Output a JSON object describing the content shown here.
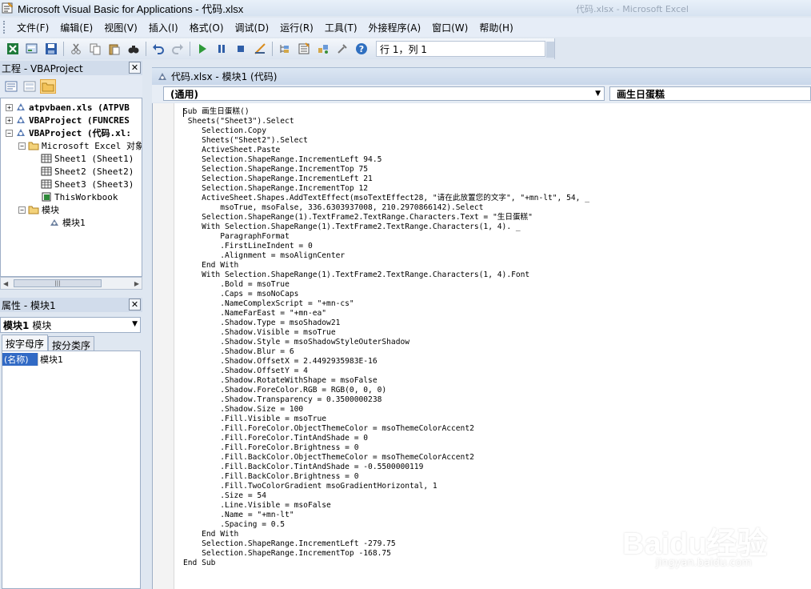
{
  "window": {
    "title": "Microsoft Visual Basic for Applications - 代码.xlsx",
    "background_window_title": "代码.xlsx - Microsoft Excel"
  },
  "menu": {
    "items": [
      "文件(F)",
      "编辑(E)",
      "视图(V)",
      "插入(I)",
      "格式(O)",
      "调试(D)",
      "运行(R)",
      "工具(T)",
      "外接程序(A)",
      "窗口(W)",
      "帮助(H)"
    ]
  },
  "toolbar": {
    "position_text": "行 1，列 1"
  },
  "project": {
    "title": "工程 - VBAProject",
    "tree": [
      "atpvbaen.xls (ATPVB",
      "VBAProject (FUNCRES",
      "VBAProject (代码.xl:",
      "Microsoft Excel 对象",
      "Sheet1 (Sheet1)",
      "Sheet2 (Sheet2)",
      "Sheet3 (Sheet3)",
      "ThisWorkbook",
      "模块",
      "模块1"
    ]
  },
  "properties": {
    "title": "属性 - 模块1",
    "object_name": "模块1",
    "object_type": "模块",
    "tabs": [
      "按字母序",
      "按分类序"
    ],
    "row_key": "(名称)",
    "row_value": "模块1"
  },
  "code_window": {
    "title": "代码.xlsx - 模块1 (代码)",
    "object_combo": "(通用)",
    "procedure_combo": "画生日蛋糕",
    "lines": [
      "Sub 画生日蛋糕()",
      " Sheets(\"Sheet3\").Select",
      "    Selection.Copy",
      "    Sheets(\"Sheet2\").Select",
      "    ActiveSheet.Paste",
      "    Selection.ShapeRange.IncrementLeft 94.5",
      "    Selection.ShapeRange.IncrementTop 75",
      "    Selection.ShapeRange.IncrementLeft 21",
      "    Selection.ShapeRange.IncrementTop 12",
      "    ActiveSheet.Shapes.AddTextEffect(msoTextEffect28, \"请在此放置您的文字\", \"+mn-lt\", 54, _",
      "        msoTrue, msoFalse, 336.6303937008, 210.2970866142).Select",
      "    Selection.ShapeRange(1).TextFrame2.TextRange.Characters.Text = \"生日蛋糕\"",
      "    With Selection.ShapeRange(1).TextFrame2.TextRange.Characters(1, 4). _",
      "        ParagraphFormat",
      "        .FirstLineIndent = 0",
      "        .Alignment = msoAlignCenter",
      "    End With",
      "    With Selection.ShapeRange(1).TextFrame2.TextRange.Characters(1, 4).Font",
      "        .Bold = msoTrue",
      "        .Caps = msoNoCaps",
      "        .NameComplexScript = \"+mn-cs\"",
      "        .NameFarEast = \"+mn-ea\"",
      "        .Shadow.Type = msoShadow21",
      "        .Shadow.Visible = msoTrue",
      "        .Shadow.Style = msoShadowStyleOuterShadow",
      "        .Shadow.Blur = 6",
      "        .Shadow.OffsetX = 2.4492935983E-16",
      "        .Shadow.OffsetY = 4",
      "        .Shadow.RotateWithShape = msoFalse",
      "        .Shadow.ForeColor.RGB = RGB(0, 0, 0)",
      "        .Shadow.Transparency = 0.3500000238",
      "        .Shadow.Size = 100",
      "        .Fill.Visible = msoTrue",
      "        .Fill.ForeColor.ObjectThemeColor = msoThemeColorAccent2",
      "        .Fill.ForeColor.TintAndShade = 0",
      "        .Fill.ForeColor.Brightness = 0",
      "        .Fill.BackColor.ObjectThemeColor = msoThemeColorAccent2",
      "        .Fill.BackColor.TintAndShade = -0.5500000119",
      "        .Fill.BackColor.Brightness = 0",
      "        .Fill.TwoColorGradient msoGradientHorizontal, 1",
      "        .Size = 54",
      "        .Line.Visible = msoFalse",
      "        .Name = \"+mn-lt\"",
      "        .Spacing = 0.5",
      "    End With",
      "    Selection.ShapeRange.IncrementLeft -279.75",
      "    Selection.ShapeRange.IncrementTop -168.75",
      "End Sub"
    ]
  },
  "watermark": {
    "main": "Baidu经验",
    "sub": "jingyan.baidu.com"
  },
  "colors": {
    "chrome": "#dfe7f1",
    "selection": "#316ac5",
    "keyword": "#00008b"
  }
}
